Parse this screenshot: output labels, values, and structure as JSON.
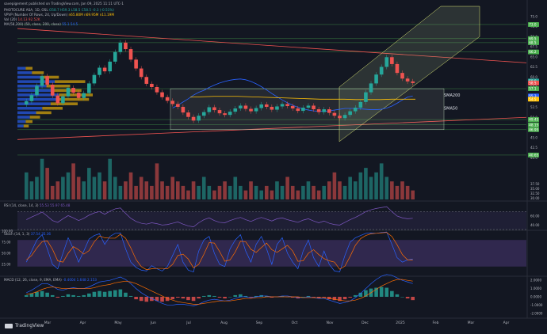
{
  "header": {
    "published_line": "savepigement published on TradingView.com, Jan 09, 2025 11:11 UTC-1",
    "symbol_line": "PHOTOCURE ASA, 1D, OSL",
    "symbol_ohlc": "O58.7 H59.3 L58.5 C58.5 -0.3 (-0.51%)",
    "vpvr_line": "VPVP (Number Of Rows, 24, Up/Down)",
    "vpvr_values": "n65.80M n69.95M n11.19M",
    "vol_line": "Vol (20)",
    "vol_values": "14.13 92.52K",
    "ma_line": "MA(58,200) (50, close, 200, close)",
    "ma_values": "55.1 54.5"
  },
  "colors": {
    "background": "#131722",
    "up": "#26a69a",
    "down": "#ef5350",
    "ma50": "#2962ff",
    "ma200": "#ffc107",
    "rsi": "#7e57c2",
    "channel": "#c5e1a5",
    "box": "#fffde7"
  },
  "chart_data": [
    {
      "id": "price",
      "type": "candlestick",
      "ylim": [
        37.5,
        77.5
      ],
      "y_ticks": [
        40.0,
        42.5,
        45.0,
        47.5,
        50.0,
        52.5,
        55.0,
        57.5,
        60.0,
        62.5,
        65.0,
        67.5,
        70.0,
        72.5,
        75.0
      ],
      "x_labels": [
        "Mar",
        "Apr",
        "May",
        "Jun",
        "Jul",
        "Aug",
        "Sep",
        "Oct",
        "Nov",
        "Dec",
        "2025",
        "Feb",
        "Mar",
        "Apr"
      ],
      "price_tags": [
        {
          "label": "73.0",
          "value": 73.0,
          "color": "#4caf50"
        },
        {
          "label": "69.5",
          "value": 69.5,
          "color": "#4caf50"
        },
        {
          "label": "68.5",
          "value": 68.5,
          "color": "#4caf50"
        },
        {
          "label": "66.2",
          "value": 66.2,
          "color": "#4caf50"
        },
        {
          "label": "59.0",
          "value": 59.0,
          "color": "#26a69a"
        },
        {
          "label": "58.5",
          "value": 58.5,
          "color": "#ef5350"
        },
        {
          "label": "57.1",
          "value": 57.1,
          "color": "#4caf50"
        },
        {
          "label": "55.3",
          "value": 55.3,
          "color": "#2962ff"
        },
        {
          "label": "54.5",
          "value": 54.5,
          "color": "#ffc107"
        },
        {
          "label": "49.45",
          "value": 49.45,
          "color": "#4caf50"
        },
        {
          "label": "48.15",
          "value": 48.15,
          "color": "#4caf50"
        },
        {
          "label": "46.95",
          "value": 46.95,
          "color": "#4caf50"
        },
        {
          "label": "40.65",
          "value": 40.65,
          "color": "#4caf50"
        }
      ],
      "annotations": [
        {
          "text": "SMA200",
          "x_month": "Dec",
          "value": 55.4
        },
        {
          "text": "SMA50",
          "x_month": "Dec",
          "value": 52.2
        }
      ],
      "horizontal_levels": [
        73.0,
        69.5,
        68.5,
        66.2,
        57.1,
        49.45,
        48.15,
        46.95,
        40.65
      ],
      "series": [
        {
          "name": "close",
          "values": [
            54.0,
            55.5,
            57.8,
            60.2,
            58.1,
            55.4,
            53.5,
            55.2,
            57.3,
            56.1,
            54.8,
            56.0,
            58.4,
            60.5,
            62.3,
            61.4,
            63.8,
            66.2,
            68.5,
            66.9,
            64.3,
            62.1,
            60.0,
            58.3,
            57.5,
            56.2,
            55.0,
            54.1,
            53.3,
            52.6,
            51.2,
            50.1,
            49.2,
            50.4,
            51.3,
            52.5,
            51.8,
            51.0,
            50.6,
            51.4,
            52.2,
            52.9,
            52.1,
            51.5,
            52.3,
            53.2,
            52.6,
            51.9,
            52.7,
            53.3,
            52.8,
            52.2,
            51.6,
            52.4,
            52.9,
            52.0,
            51.3,
            52.0,
            51.1,
            50.4,
            49.8,
            50.6,
            51.5,
            52.4,
            53.8,
            56.2,
            58.4,
            60.6,
            62.5,
            64.9,
            63.2,
            61.0,
            59.6,
            58.9,
            58.5
          ]
        },
        {
          "name": "MA 50",
          "values": [
            52.3,
            53.0,
            53.8,
            54.6,
            55.5,
            56.2,
            56.7,
            57.4,
            58.0,
            58.5,
            58.9,
            59.2,
            59.4,
            59.5,
            59.3,
            58.9,
            58.3,
            57.6,
            56.8,
            55.9,
            55.1,
            54.3,
            53.6,
            53.0,
            52.5,
            52.1,
            51.8,
            51.6,
            51.5,
            51.5,
            51.6,
            51.8,
            52.0,
            52.2,
            52.2,
            52.2,
            52.1,
            52.0,
            51.9,
            51.9,
            52.0,
            52.3,
            52.8,
            53.5,
            54.3,
            55.0,
            55.3
          ]
        },
        {
          "name": "MA 200",
          "values": [
            55.0,
            55.1,
            55.2,
            55.2,
            55.2,
            55.1,
            55.0,
            54.9,
            54.8,
            54.7,
            54.6,
            54.5,
            54.5,
            54.5,
            54.4,
            54.4,
            54.4,
            54.5,
            54.5,
            54.5
          ]
        }
      ]
    },
    {
      "id": "volume",
      "type": "bar",
      "title": "",
      "values": [
        0.6,
        0.4,
        0.5,
        0.9,
        0.7,
        0.3,
        0.4,
        0.5,
        0.6,
        0.8,
        0.5,
        0.4,
        0.7,
        0.5,
        0.6,
        0.4,
        0.9,
        0.5,
        0.3,
        0.4,
        0.6,
        0.3,
        0.5,
        0.4,
        0.3,
        0.8,
        0.4,
        0.3,
        0.5,
        0.4,
        0.3,
        0.2,
        0.4,
        0.3,
        0.5,
        0.3,
        0.2,
        0.3,
        0.4,
        0.3,
        0.5,
        0.3,
        0.2,
        0.4,
        0.3,
        0.2,
        0.3,
        0.2,
        0.4,
        0.3,
        0.5,
        0.3,
        0.2,
        0.3,
        0.4,
        0.3,
        0.2,
        0.3,
        0.4,
        0.6,
        0.4,
        0.3,
        0.5,
        0.4,
        0.6,
        0.7,
        0.5,
        0.6,
        0.8,
        0.5,
        0.4,
        0.3,
        0.4,
        0.3,
        0.2
      ]
    },
    {
      "id": "rsi",
      "type": "line",
      "header": "RSI (14, close, 14, 3)",
      "header_values": "55.53  55.97  65.48",
      "ylim": [
        30,
        90
      ],
      "y_ticks": [
        60.0,
        40.0
      ],
      "bands": [
        30,
        70
      ],
      "series": [
        {
          "name": "RSI",
          "values": [
            52,
            58,
            63,
            69,
            60,
            50,
            46,
            54,
            61,
            56,
            50,
            55,
            62,
            67,
            70,
            64,
            71,
            76,
            78,
            66,
            55,
            48,
            44,
            42,
            45,
            43,
            40,
            41,
            44,
            47,
            42,
            38,
            36,
            45,
            52,
            56,
            50,
            46,
            45,
            50,
            54,
            57,
            52,
            48,
            53,
            57,
            53,
            49,
            54,
            56,
            52,
            49,
            46,
            51,
            54,
            49,
            45,
            49,
            44,
            41,
            40,
            46,
            52,
            57,
            63,
            70,
            74,
            77,
            79,
            81,
            70,
            60,
            56,
            54,
            55
          ]
        }
      ]
    },
    {
      "id": "stoch",
      "type": "line",
      "header": "Stoch (14, 1, 3)",
      "header_values": "37.54  35.36",
      "ylim": [
        0,
        100
      ],
      "y_ticks": [
        100.0,
        75.0,
        50.0,
        25.0
      ],
      "bands": [
        20,
        80
      ],
      "series": [
        {
          "name": "%K",
          "values": [
            30,
            55,
            80,
            92,
            60,
            25,
            15,
            50,
            85,
            60,
            30,
            55,
            82,
            90,
            94,
            70,
            88,
            95,
            96,
            60,
            30,
            18,
            12,
            10,
            22,
            15,
            10,
            20,
            45,
            70,
            30,
            12,
            8,
            55,
            80,
            88,
            50,
            25,
            20,
            60,
            80,
            92,
            55,
            30,
            70,
            88,
            60,
            25,
            70,
            85,
            50,
            30,
            15,
            55,
            80,
            40,
            20,
            55,
            25,
            10,
            8,
            45,
            75,
            85,
            90,
            95,
            96,
            95,
            97,
            98,
            70,
            40,
            30,
            35,
            37
          ]
        },
        {
          "name": "%D",
          "values": [
            35,
            45,
            62,
            76,
            78,
            59,
            33,
            30,
            50,
            65,
            58,
            48,
            56,
            76,
            89,
            85,
            84,
            84,
            93,
            84,
            62,
            36,
            20,
            13,
            15,
            16,
            16,
            15,
            25,
            45,
            48,
            37,
            17,
            25,
            48,
            74,
            73,
            54,
            32,
            35,
            53,
            77,
            76,
            59,
            52,
            63,
            73,
            58,
            52,
            60,
            68,
            55,
            32,
            33,
            50,
            58,
            47,
            38,
            33,
            30,
            14,
            21,
            43,
            68,
            83,
            90,
            94,
            95,
            96,
            97,
            88,
            69,
            47,
            35,
            35
          ]
        }
      ]
    },
    {
      "id": "macd",
      "type": "bar",
      "header": "MACD (12, 26, close, 9, EMA, EMA)",
      "header_values": "-0.4004  1.648  2.153",
      "ylim": [
        -2.4,
        2.4
      ],
      "y_ticks": [
        2.0,
        1.0,
        0.0,
        -1.0,
        -2.0
      ],
      "values": [
        0.2,
        0.4,
        0.6,
        0.7,
        0.5,
        0.2,
        -0.1,
        0.1,
        0.3,
        0.2,
        0.1,
        0.2,
        0.4,
        0.6,
        0.7,
        0.6,
        0.7,
        0.8,
        0.9,
        0.5,
        0.1,
        -0.3,
        -0.5,
        -0.6,
        -0.5,
        -0.5,
        -0.6,
        -0.5,
        -0.3,
        -0.1,
        -0.2,
        -0.4,
        -0.5,
        -0.2,
        0.1,
        0.2,
        0.1,
        -0.1,
        -0.2,
        0.0,
        0.2,
        0.3,
        0.1,
        -0.1,
        0.1,
        0.2,
        0.1,
        -0.1,
        0.0,
        0.1,
        0.0,
        -0.1,
        -0.2,
        0.0,
        0.1,
        -0.1,
        -0.2,
        -0.1,
        -0.3,
        -0.4,
        -0.5,
        -0.3,
        -0.1,
        0.2,
        0.5,
        0.8,
        1.0,
        1.1,
        1.2,
        1.1,
        0.7,
        0.3,
        0.0,
        -0.2,
        -0.4
      ],
      "series": [
        {
          "name": "MACD",
          "values": [
            0.5,
            0.8,
            1.2,
            1.6,
            1.6,
            1.3,
            0.9,
            0.8,
            1.0,
            1.1,
            1.0,
            1.0,
            1.2,
            1.5,
            1.8,
            1.9,
            2.0,
            2.2,
            2.4,
            2.1,
            1.6,
            1.0,
            0.5,
            0.1,
            -0.2,
            -0.5,
            -0.8,
            -1.0,
            -1.0,
            -0.9,
            -0.9,
            -1.0,
            -1.1,
            -0.9,
            -0.6,
            -0.4,
            -0.3,
            -0.4,
            -0.5,
            -0.4,
            -0.2,
            0.0,
            0.0,
            -0.1,
            0.0,
            0.1,
            0.1,
            0.0,
            0.0,
            0.1,
            0.1,
            0.0,
            -0.1,
            -0.1,
            0.0,
            -0.1,
            -0.2,
            -0.2,
            -0.4,
            -0.6,
            -0.8,
            -0.7,
            -0.5,
            -0.1,
            0.4,
            1.0,
            1.6,
            2.1,
            2.5,
            2.7,
            2.6,
            2.3,
            2.0,
            1.8,
            1.6
          ]
        },
        {
          "name": "Signal",
          "values": [
            0.3,
            0.4,
            0.6,
            0.9,
            1.1,
            1.2,
            1.1,
            1.0,
            1.0,
            1.0,
            1.0,
            1.0,
            1.0,
            1.1,
            1.3,
            1.4,
            1.5,
            1.7,
            1.8,
            1.9,
            1.8,
            1.6,
            1.3,
            1.0,
            0.7,
            0.4,
            0.1,
            -0.2,
            -0.4,
            -0.6,
            -0.7,
            -0.8,
            -0.9,
            -0.9,
            -0.8,
            -0.7,
            -0.6,
            -0.5,
            -0.5,
            -0.5,
            -0.4,
            -0.3,
            -0.2,
            -0.2,
            -0.1,
            -0.1,
            0.0,
            0.0,
            0.0,
            0.0,
            0.0,
            0.0,
            0.0,
            -0.1,
            -0.1,
            -0.1,
            -0.1,
            -0.1,
            -0.2,
            -0.3,
            -0.4,
            -0.5,
            -0.5,
            -0.4,
            -0.2,
            0.1,
            0.5,
            0.9,
            1.3,
            1.6,
            1.9,
            2.1,
            2.1,
            2.0,
            1.9
          ]
        }
      ]
    }
  ],
  "watermark": "TradingView"
}
